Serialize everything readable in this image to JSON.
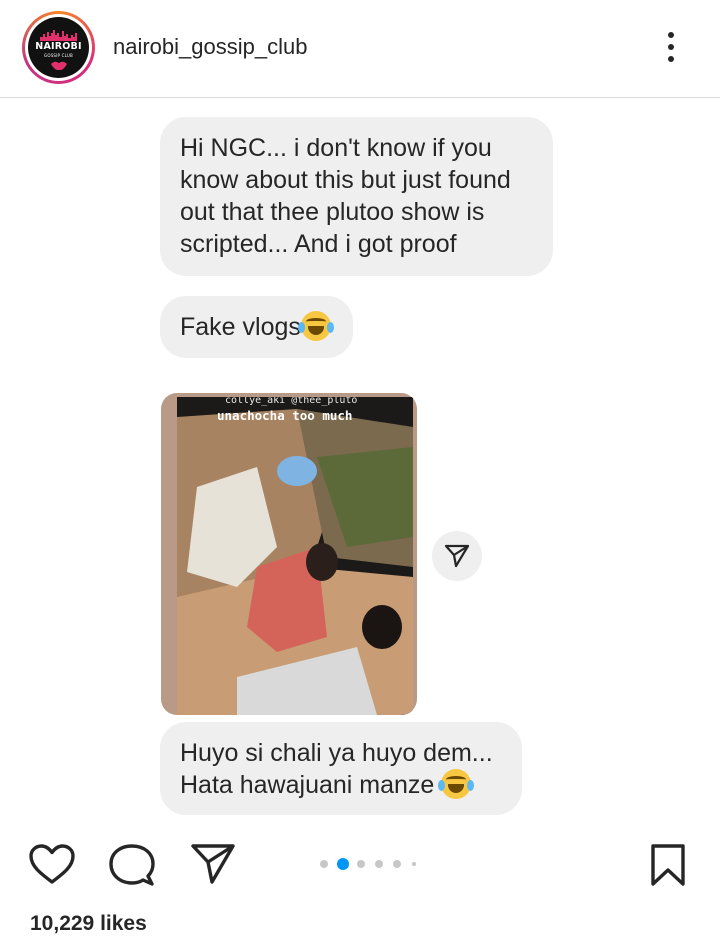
{
  "header": {
    "username": "nairobi_gossip_club",
    "avatar_brand": "NAIROBI",
    "avatar_sub": "GOSSIP CLUB",
    "more_icon": "more-vertical-icon"
  },
  "messages": [
    {
      "lines": [
        "Hi NGC... i don't know if you",
        "know about this but just found",
        "out that thee plutoo show is",
        "scripted... And i got proof"
      ]
    },
    {
      "text": "Fake vlogs",
      "emoji": "face-with-tears-of-joy"
    },
    {
      "lines": [
        "Huyo si chali ya huyo dem...",
        "Hata hawajuani manze"
      ],
      "emoji": "face-with-tears-of-joy"
    }
  ],
  "media": {
    "caption_user": "collye_aki @thee_pluto",
    "caption_text": "unachocha too much"
  },
  "actions": {
    "like_icon": "heart-icon",
    "comment_icon": "comment-icon",
    "share_icon": "send-icon",
    "save_icon": "bookmark-icon",
    "carousel_count": 6,
    "carousel_active": 1
  },
  "likes_text": "10,229 likes",
  "colors": {
    "bubble": "#efefef",
    "accent": "#0095f6",
    "text": "#262626"
  }
}
